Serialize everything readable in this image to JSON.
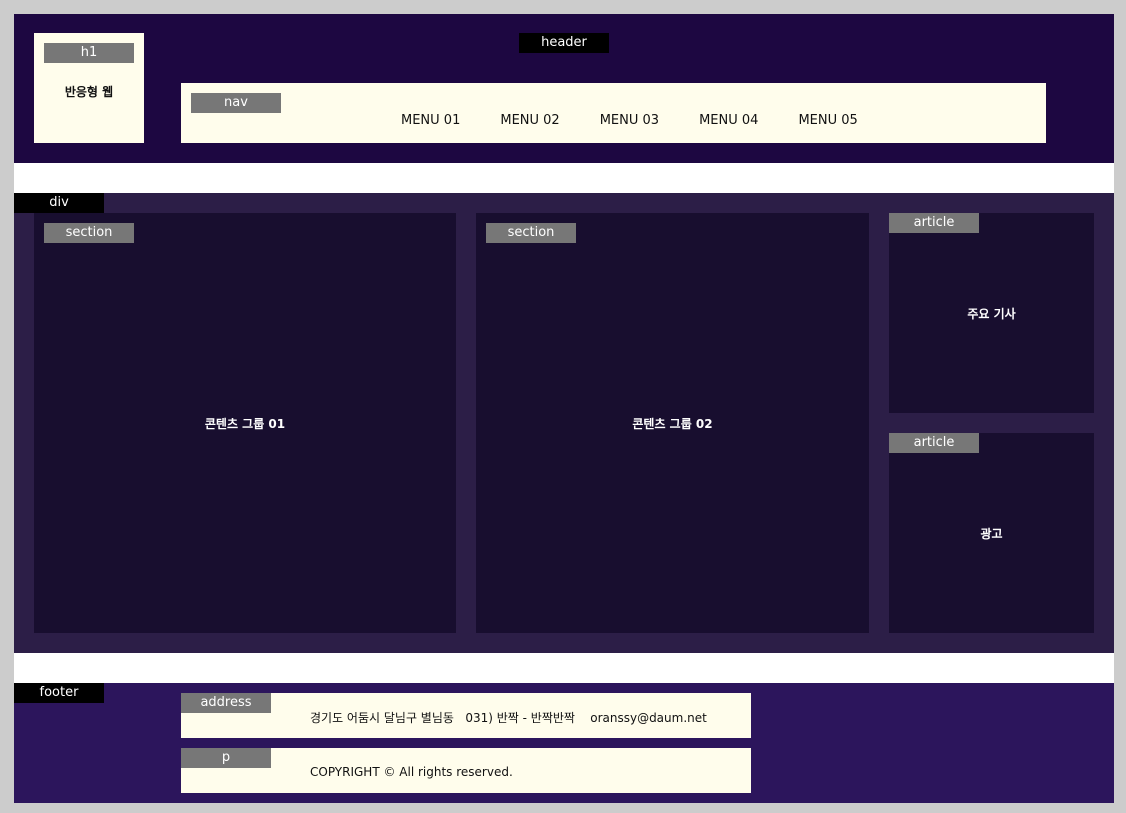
{
  "header": {
    "tag": "header",
    "logo": {
      "tag": "h1",
      "text": "반응형 웹"
    },
    "nav": {
      "tag": "nav",
      "menu": [
        "MENU 01",
        "MENU 02",
        "MENU 03",
        "MENU 04",
        "MENU 05"
      ]
    }
  },
  "main": {
    "tag": "div",
    "sections": [
      {
        "tag": "section",
        "text": "콘텐츠 그룹 01"
      },
      {
        "tag": "section",
        "text": "콘텐츠 그룹 02"
      }
    ],
    "articles": [
      {
        "tag": "article",
        "text": "주요 기사"
      },
      {
        "tag": "article",
        "text": "광고"
      }
    ]
  },
  "footer": {
    "tag": "footer",
    "address": {
      "tag": "address",
      "text": "경기도 어둠시 달님구 별님동   031) 반짝 - 반짝반짝    oranssy@daum.net"
    },
    "p": {
      "tag": "p",
      "text": "COPYRIGHT © All rights reserved."
    }
  },
  "colors": {
    "header_bg": "#1d0741",
    "container_bg": "#2c1e47",
    "panel_bg": "#180e2f",
    "footer_bg": "#2c155c",
    "box_bg": "#fffdec",
    "label_gray": "#777777"
  }
}
